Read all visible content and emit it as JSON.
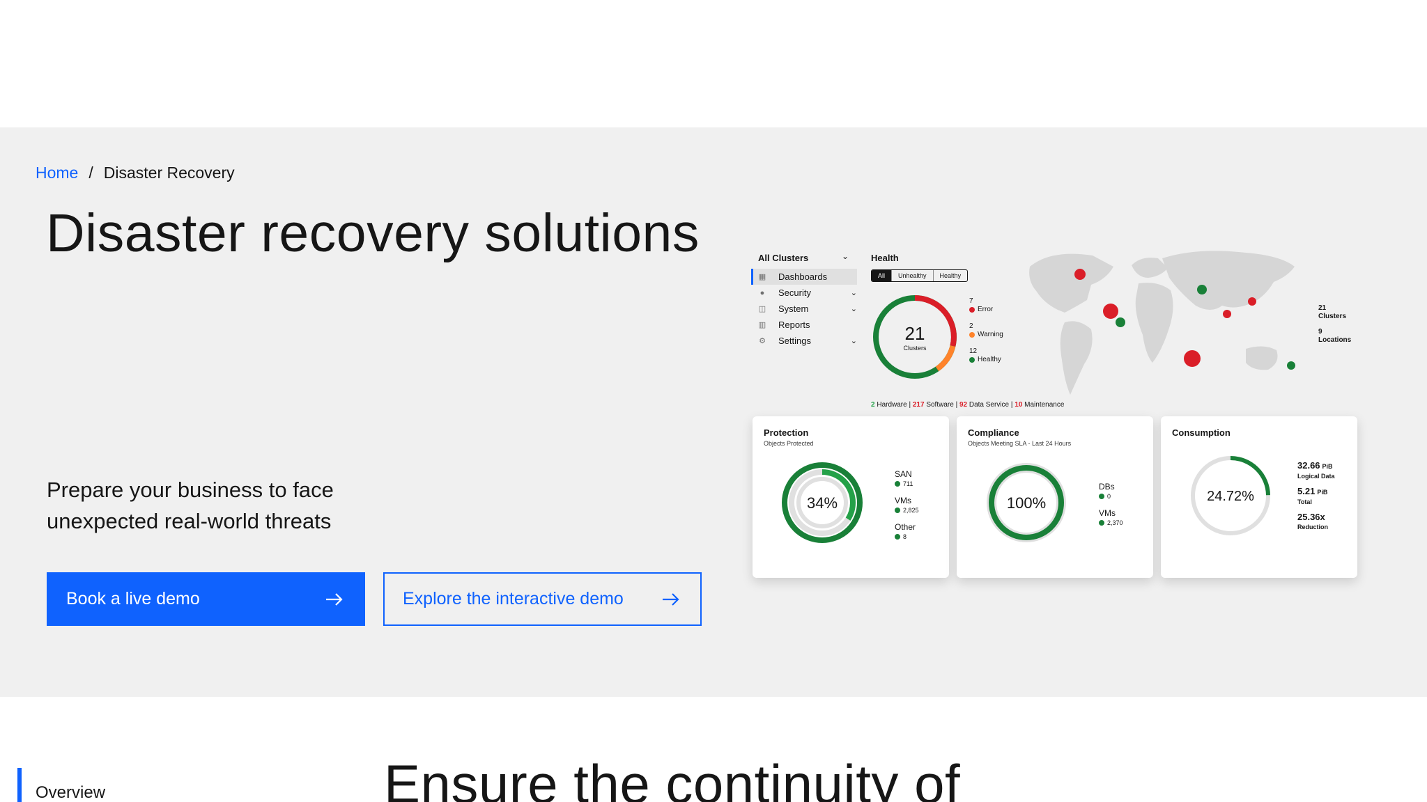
{
  "breadcrumb": {
    "home": "Home",
    "separator": "/",
    "current": "Disaster Recovery"
  },
  "hero": {
    "title": "Disaster recovery solutions",
    "lead": "Prepare your business to face unexpected real-world threats",
    "primary_cta": "Book a live demo",
    "secondary_cta": "Explore the interactive demo"
  },
  "dashboard": {
    "nav_title": "All Clusters",
    "nav_items": [
      {
        "label": "Dashboards",
        "icon": "dashboard-icon"
      },
      {
        "label": "Security",
        "icon": "shield-icon"
      },
      {
        "label": "System",
        "icon": "cube-icon"
      },
      {
        "label": "Reports",
        "icon": "report-icon"
      },
      {
        "label": "Settings",
        "icon": "gear-icon"
      }
    ],
    "health": {
      "title": "Health",
      "filters": [
        "All",
        "Unhealthy",
        "Healthy"
      ],
      "total": "21",
      "total_label": "Clusters",
      "legend": [
        {
          "count": "7",
          "label": "Error",
          "color": "#da1e28"
        },
        {
          "count": "2",
          "label": "Warning",
          "color": "#ff832b"
        },
        {
          "count": "12",
          "label": "Healthy",
          "color": "#198038"
        }
      ],
      "summary": {
        "hardware_count": "2",
        "hardware_label": " Hardware | ",
        "software_count": "217",
        "software_label": " Software | ",
        "dataservice_count": "92",
        "dataservice_label": " Data Service | ",
        "maintenance_count": "10",
        "maintenance_label": " Maintenance"
      }
    },
    "map_stats": [
      {
        "value": "21",
        "label": "Clusters"
      },
      {
        "value": "9",
        "label": "Locations"
      }
    ],
    "protection": {
      "title": "Protection",
      "subtitle": "Objects Protected",
      "center": "34%",
      "percent": 34,
      "legend": [
        {
          "label": "SAN",
          "value": "711"
        },
        {
          "label": "VMs",
          "value": "2,825"
        },
        {
          "label": "Other",
          "value": "8"
        }
      ]
    },
    "compliance": {
      "title": "Compliance",
      "subtitle": "Objects Meeting SLA - Last 24 Hours",
      "center": "100%",
      "percent": 100,
      "legend": [
        {
          "label": "DBs",
          "value": "0"
        },
        {
          "label": "VMs",
          "value": "2,370"
        }
      ]
    },
    "consumption": {
      "title": "Consumption",
      "center": "24.72%",
      "percent": 24.72,
      "stats": [
        {
          "value": "32.66",
          "unit": "PiB",
          "label": "Logical Data"
        },
        {
          "value": "5.21",
          "unit": "PiB",
          "label": "Total"
        },
        {
          "value": "25.36x",
          "unit": "",
          "label": "Reduction"
        }
      ]
    },
    "colors": {
      "green": "#198038",
      "red": "#da1e28",
      "orange": "#ff832b",
      "ring_bg": "#e0e0e0"
    }
  },
  "below": {
    "sidenav_item": "Overview",
    "heading": "Ensure the continuity of"
  }
}
